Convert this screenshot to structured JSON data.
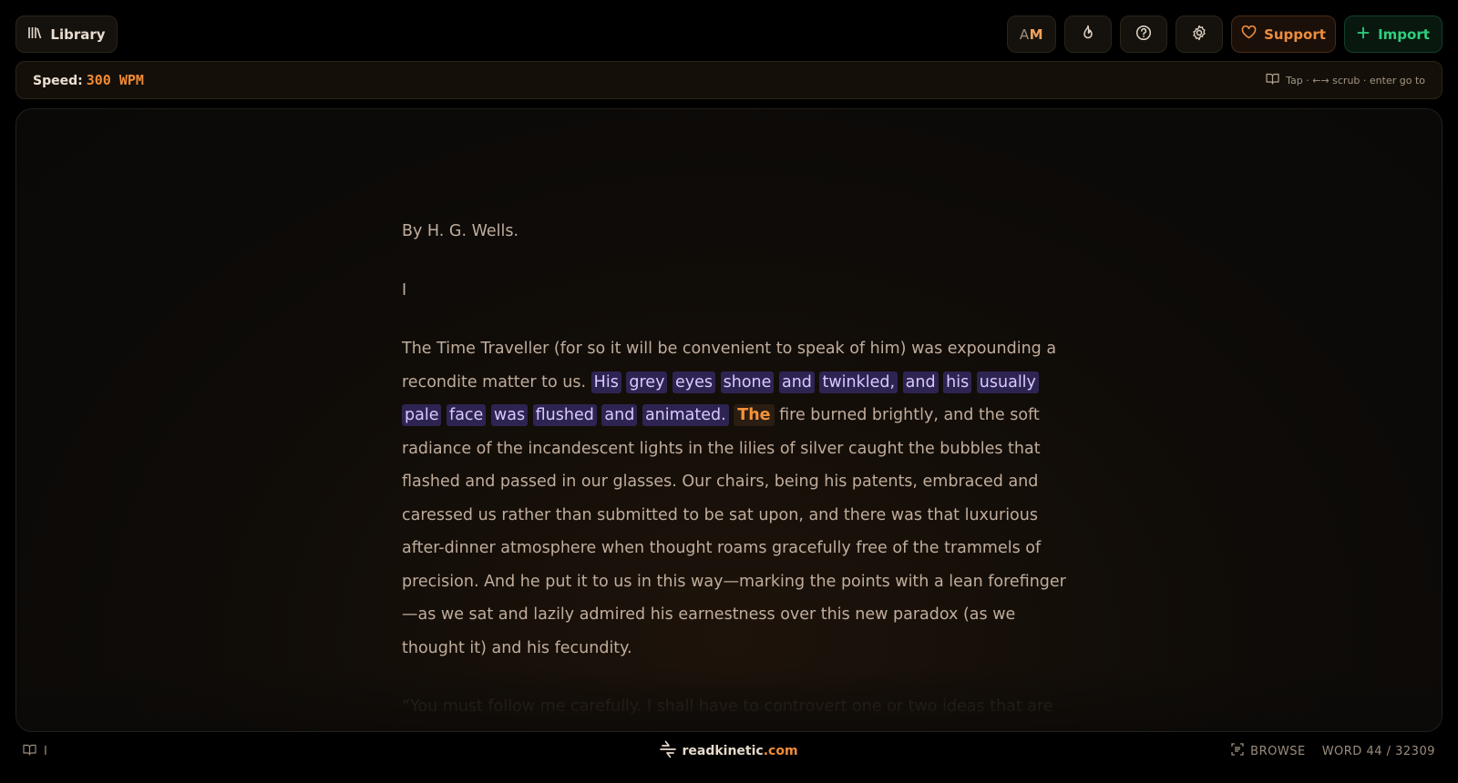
{
  "header": {
    "library_label": "Library",
    "am_label_a": "A",
    "am_label_m": "M",
    "support_label": "Support",
    "import_label": "Import"
  },
  "speedbar": {
    "speed_label": "Speed:",
    "speed_value": "300 WPM",
    "hint": "Tap · ←→ scrub · enter go to"
  },
  "reader": {
    "byline": "By H. G. Wells.",
    "chapter": "I",
    "p1_start": "The Time Traveller (for so it will be convenient to speak of him) was expounding a recondite matter to us.",
    "highlight_words": [
      "His",
      "grey",
      "eyes",
      "shone",
      "and",
      "twinkled,",
      "and",
      "his",
      "usually",
      "pale",
      "face",
      "was",
      "flushed",
      "and",
      "animated."
    ],
    "current_word": "The",
    "p1_rest": "fire burned brightly, and the soft radiance of the incandescent lights in the lilies of silver caught the bubbles that flashed and passed in our glasses. Our chairs, being his patents, embraced and caressed us rather than submitted to be sat upon, and there was that luxurious after-dinner atmosphere when thought roams gracefully free of the trammels of precision. And he put it to us in this way—marking the points with a lean forefinger—as we sat and lazily admired his earnestness over this new paradox (as we thought it) and his fecundity.",
    "p2_partial": "“You must follow me carefully. I shall have to controvert one or two ideas that are"
  },
  "footer": {
    "chapter_indicator": "I",
    "brand_name": "readkinetic",
    "brand_tld": ".com",
    "browse_label": "BROWSE",
    "word_counter": "WORD 44 / 32309"
  },
  "colors": {
    "accent_orange": "#f08a35",
    "highlight_purple": "#2e2452",
    "import_green": "#2fd07e"
  }
}
